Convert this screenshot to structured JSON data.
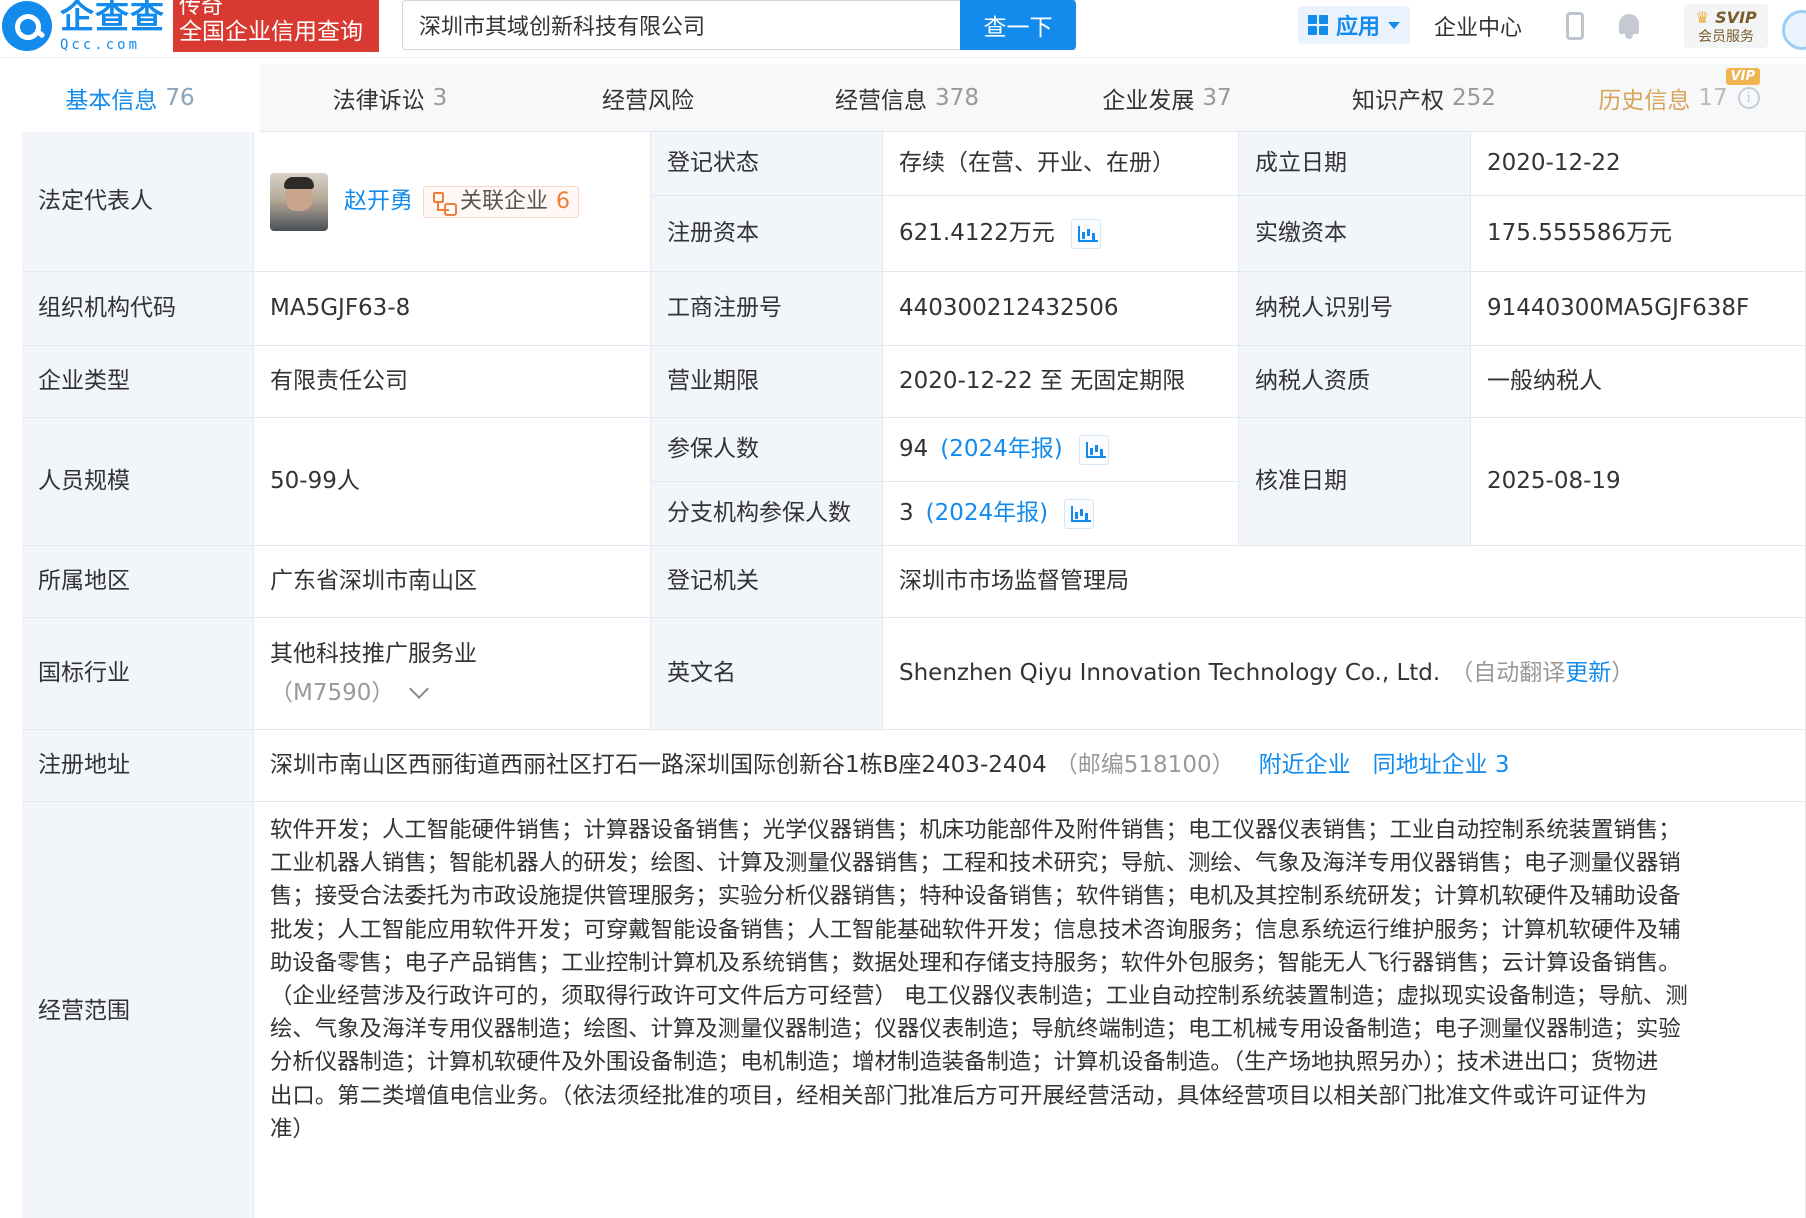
{
  "header": {
    "logo_cn": "企查查",
    "logo_en": "Qcc.com",
    "badge_line1": "传奇",
    "badge_line2": "全国企业信用查询",
    "search_value": "深圳市其域创新科技有限公司",
    "search_button": "查一下",
    "apps_label": "应用",
    "enterprise_center": "企业中心",
    "svip_line1": "SVIP",
    "svip_line2": "会员服务",
    "colors": {
      "brand": "#128bed",
      "badge": "#d83a31"
    }
  },
  "tabs": [
    {
      "label": "基本信息",
      "count": "76",
      "active": true
    },
    {
      "label": "法律诉讼",
      "count": "3"
    },
    {
      "label": "经营风险",
      "count": ""
    },
    {
      "label": "经营信息",
      "count": "378"
    },
    {
      "label": "企业发展",
      "count": "37"
    },
    {
      "label": "知识产权",
      "count": "252"
    },
    {
      "label": "历史信息",
      "count": "17",
      "vip": "VIP"
    }
  ],
  "info": {
    "legal_rep_label": "法定代表人",
    "legal_rep_name": "赵开勇",
    "related_label": "关联企业",
    "related_count": "6",
    "reg_status_label": "登记状态",
    "reg_status": "存续（在营、开业、在册）",
    "founded_label": "成立日期",
    "founded": "2020-12-22",
    "reg_capital_label": "注册资本",
    "reg_capital": "621.4122万元",
    "paid_capital_label": "实缴资本",
    "paid_capital": "175.555586万元",
    "org_code_label": "组织机构代码",
    "org_code": "MA5GJF63-8",
    "biz_reg_no_label": "工商注册号",
    "biz_reg_no": "440300212432506",
    "taxpayer_id_label": "纳税人识别号",
    "taxpayer_id": "91440300MA5GJF638F",
    "company_type_label": "企业类型",
    "company_type": "有限责任公司",
    "biz_term_label": "营业期限",
    "biz_term": "2020-12-22 至 无固定期限",
    "taxpayer_qual_label": "纳税人资质",
    "taxpayer_qual": "一般纳税人",
    "staff_size_label": "人员规模",
    "staff_size": "50-99人",
    "insured_label": "参保人数",
    "insured": "94",
    "insured_report": "(2024年报)",
    "branch_insured_label": "分支机构参保人数",
    "branch_insured": "3",
    "branch_insured_report": "(2024年报)",
    "approval_date_label": "核准日期",
    "approval_date": "2025-08-19",
    "region_label": "所属地区",
    "region": "广东省深圳市南山区",
    "reg_authority_label": "登记机关",
    "reg_authority": "深圳市市场监督管理局",
    "industry_label": "国标行业",
    "industry": "其他科技推广服务业",
    "industry_code": "（M7590）",
    "english_name_label": "英文名",
    "english_name": "Shenzhen Qiyu Innovation Technology Co., Ltd.",
    "auto_translate_prefix": "（自动翻译",
    "auto_translate_link": "更新",
    "auto_translate_suffix": "）",
    "address_label": "注册地址",
    "address": "深圳市南山区西丽街道西丽社区打石一路深圳国际创新谷1栋B座2403-2404",
    "postcode": "（邮编518100）",
    "nearby_link": "附近企业",
    "same_address_link": "同地址企业",
    "same_address_count": "3",
    "scope_label": "经营范围",
    "scope_lines": [
      "软件开发；人工智能硬件销售；计算器设备销售；光学仪器销售；机床功能部件及附件销售；电工仪器仪表销售；工业自动控制系统装置销售；",
      "工业机器人销售；智能机器人的研发；绘图、计算及测量仪器销售；工程和技术研究；导航、测绘、气象及海洋专用仪器销售；电子测量仪器销",
      "售；接受合法委托为市政设施提供管理服务；实验分析仪器销售；特种设备销售；软件销售；电机及其控制系统研发；计算机软硬件及辅助设备",
      "批发；人工智能应用软件开发；可穿戴智能设备销售；人工智能基础软件开发；信息技术咨询服务；信息系统运行维护服务；计算机软硬件及辅",
      "助设备零售；电子产品销售；工业控制计算机及系统销售；数据处理和存储支持服务；软件外包服务；智能无人飞行器销售；云计算设备销售。",
      "（企业经营涉及行政许可的，须取得行政许可文件后方可经营） 电工仪器仪表制造；工业自动控制系统装置制造；虚拟现实设备制造；导航、测",
      "绘、气象及海洋专用仪器制造；绘图、计算及测量仪器制造；仪器仪表制造；导航终端制造；电工机械专用设备制造；电子测量仪器制造；实验",
      "分析仪器制造；计算机软硬件及外围设备制造；电机制造；增材制造装备制造；计算机设备制造。（生产场地执照另办）；技术进出口；货物进",
      "出口。第二类增值电信业务。（依法须经批准的项目，经相关部门批准后方可开展经营活动，具体经营项目以相关部门批准文件或许可证件为",
      "准）"
    ]
  }
}
